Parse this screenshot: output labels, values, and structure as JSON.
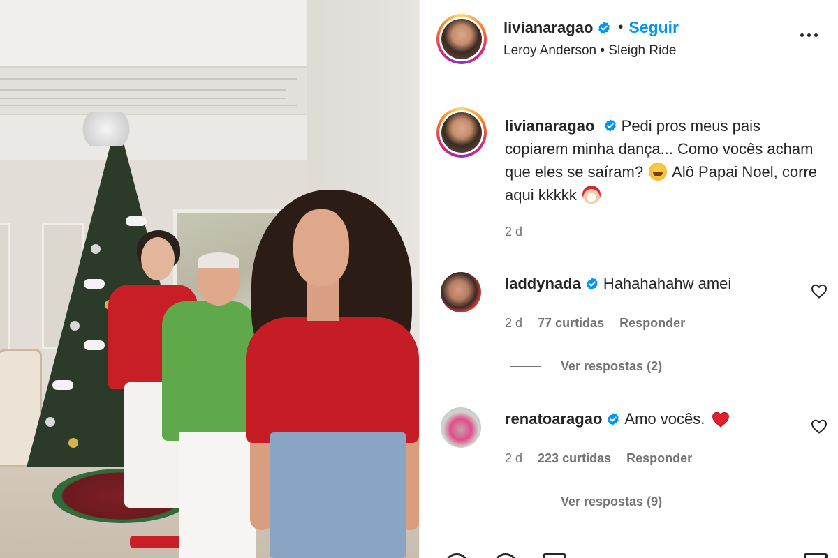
{
  "post": {
    "author": "livianaragao",
    "follow_label": "Seguir",
    "separator": "•",
    "audio": "Leroy Anderson • Sleigh Ride",
    "caption_text": "Pedi pros meus pais copiarem minha dança... Como vocês acham que eles se saíram?",
    "caption_text_2": "Alô Papai Noel, corre aqui kkkkk",
    "caption_time": "2 d"
  },
  "comments": [
    {
      "username": "laddynada",
      "text": "Hahahahahw amei",
      "time": "2 d",
      "likes": "77 curtidas",
      "reply_label": "Responder",
      "view_replies": "Ver respostas (2)"
    },
    {
      "username": "renatoaragao",
      "text": "Amo vocês.",
      "time": "2 d",
      "likes": "223 curtidas",
      "reply_label": "Responder",
      "view_replies": "Ver respostas (9)"
    }
  ],
  "colors": {
    "link": "#0095f6",
    "verified": "#0095f6",
    "text": "#262626",
    "muted": "#737373",
    "heart": "#ed4956"
  },
  "icons": {
    "verified": "verified-badge-icon",
    "more": "more-options-icon",
    "like": "heart-outline-icon",
    "emoji_laugh": "tears-of-joy-emoji",
    "emoji_santa": "santa-emoji",
    "emoji_heart": "red-heart-emoji"
  }
}
